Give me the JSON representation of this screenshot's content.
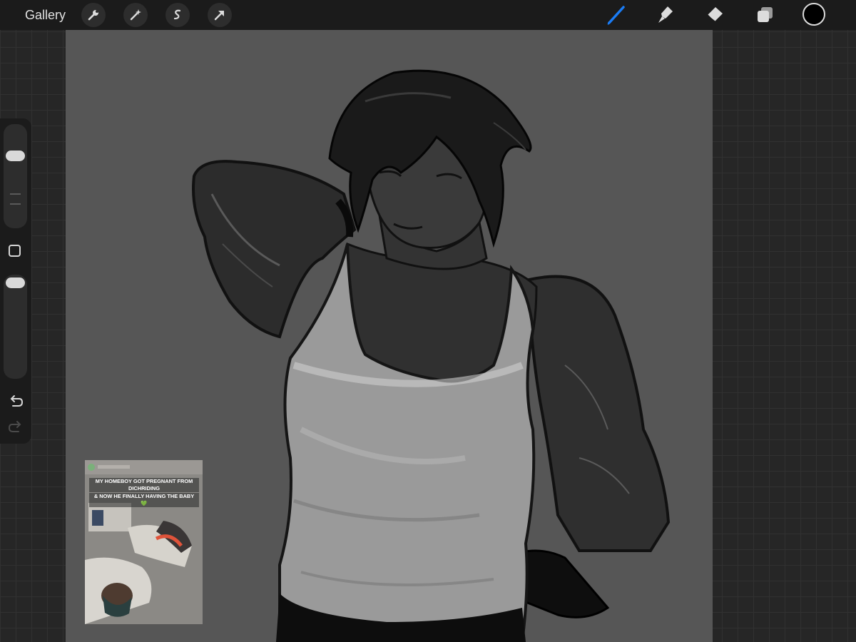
{
  "toolbar": {
    "gallery_label": "Gallery",
    "left_tools": [
      "wrench-icon",
      "magic-wand-icon",
      "selection-icon",
      "move-arrow-icon"
    ],
    "right_tools": [
      "brush-icon",
      "smudge-icon",
      "eraser-icon",
      "layers-icon"
    ],
    "active_tool": "brush-icon",
    "accent_color": "#1a7cf5",
    "current_color": "#000000"
  },
  "sidebar": {
    "brush_size_slider_icon": "brush-size-slider",
    "modify_icon": "square-modify-icon",
    "opacity_slider_icon": "opacity-slider",
    "undo_icon": "undo-icon",
    "redo_icon": "redo-icon"
  },
  "reference": {
    "caption_lines": [
      "MY HOMEBOY GOT PREGNANT FROM DICHRIDING",
      "& NOW HE FINALLY HAVING THE BABY"
    ],
    "heart": "💚"
  },
  "canvas": {
    "background": "#565656"
  }
}
